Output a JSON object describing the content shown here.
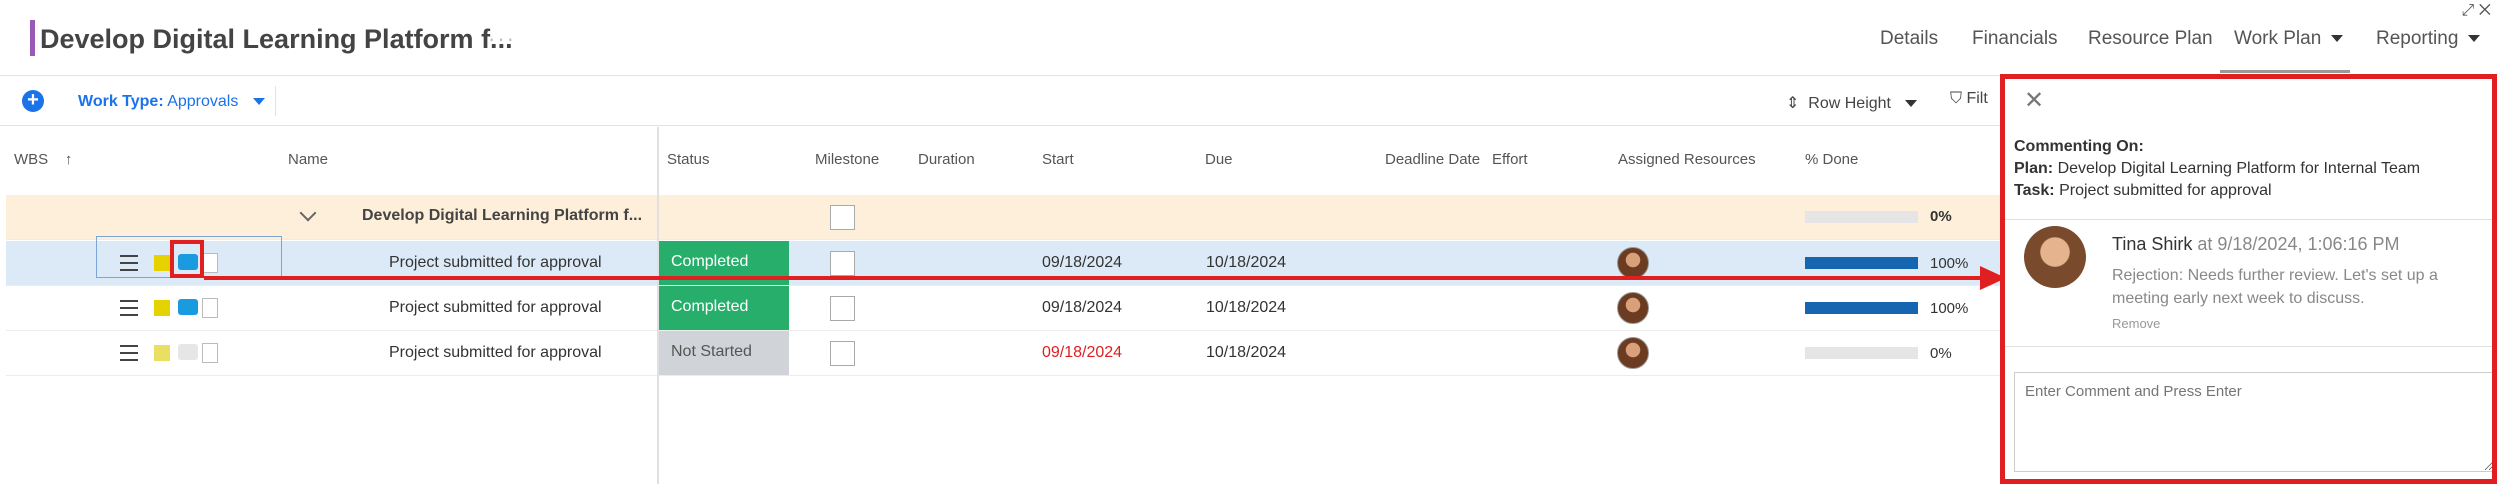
{
  "header": {
    "title": "Develop Digital Learning Platform f...",
    "more": "···",
    "nav": [
      {
        "label": "Details"
      },
      {
        "label": "Financials"
      },
      {
        "label": "Resource Plan"
      },
      {
        "label": "Work Plan"
      },
      {
        "label": "Reporting"
      }
    ],
    "active_nav": "Work Plan",
    "accent_color": "#9b59b6"
  },
  "toolbar": {
    "add_icon": "plus-circle-icon",
    "worktype_label": "Work Type:",
    "worktype_value": "Approvals",
    "row_height_label": "Row Height",
    "filter_label": "Filt"
  },
  "grid": {
    "columns": {
      "wbs": "WBS",
      "name": "Name",
      "status": "Status",
      "milestone": "Milestone",
      "duration": "Duration",
      "start": "Start",
      "due": "Due",
      "deadline": "Deadline Date",
      "effort": "Effort",
      "assigned": "Assigned Resources",
      "pct": "% Done"
    },
    "group_row": {
      "name": "Develop Digital Learning Platform f...",
      "pct_label": "0%",
      "pct_value": 0
    },
    "rows": [
      {
        "name": "Project submitted for approval",
        "status": "Completed",
        "start": "09/18/2024",
        "due": "10/18/2024",
        "pct_label": "100%",
        "pct_value": 100
      },
      {
        "name": "Project submitted for approval",
        "status": "Completed",
        "start": "09/18/2024",
        "due": "10/18/2024",
        "pct_label": "100%",
        "pct_value": 100
      },
      {
        "name": "Project submitted for approval",
        "status": "Not Started",
        "start": "09/18/2024",
        "due": "10/18/2024",
        "pct_label": "0%",
        "pct_value": 0
      }
    ],
    "status_colors": {
      "Completed": "#27ae6b",
      "Not Started": "#d0d3d8"
    }
  },
  "panel": {
    "commenting_on": "Commenting On:",
    "plan_label": "Plan:",
    "plan_value": "Develop Digital Learning Platform for Internal Team",
    "task_label": "Task:",
    "task_value": "Project submitted for approval",
    "comment": {
      "author": "Tina Shirk",
      "time": "at 9/18/2024, 1:06:16 PM",
      "text": "Rejection: Needs further review. Let's set up a meeting early next week to discuss.",
      "remove": "Remove"
    },
    "input_placeholder": "Enter Comment and Press Enter"
  }
}
